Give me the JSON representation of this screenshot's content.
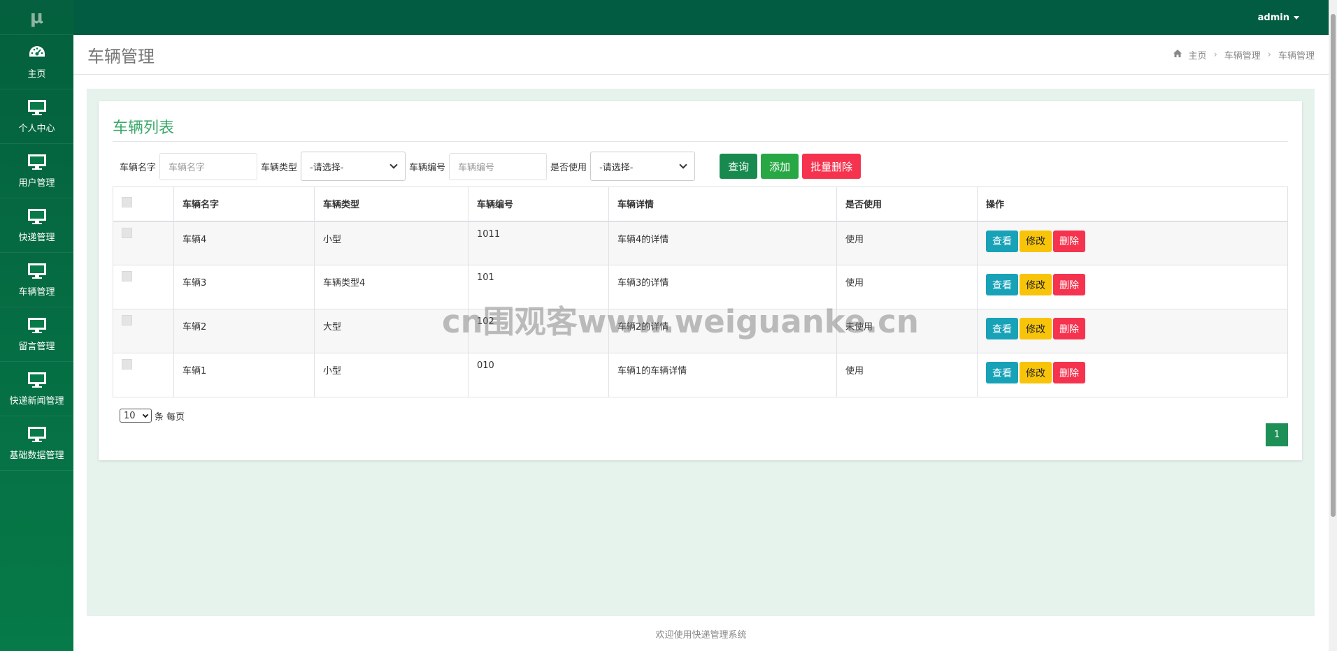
{
  "sidebar": {
    "logo": "μ",
    "items": [
      {
        "label": "主页",
        "icon": "dashboard-icon"
      },
      {
        "label": "个人中心",
        "icon": "monitor-icon"
      },
      {
        "label": "用户管理",
        "icon": "monitor-icon"
      },
      {
        "label": "快递管理",
        "icon": "monitor-icon"
      },
      {
        "label": "车辆管理",
        "icon": "monitor-icon"
      },
      {
        "label": "留言管理",
        "icon": "monitor-icon"
      },
      {
        "label": "快递新闻管理",
        "icon": "monitor-icon"
      },
      {
        "label": "基础数据管理",
        "icon": "monitor-icon"
      }
    ]
  },
  "topbar": {
    "user": "admin"
  },
  "titlebar": {
    "title": "车辆管理",
    "breadcrumb": [
      "主页",
      "车辆管理",
      "车辆管理"
    ]
  },
  "panel": {
    "title": "车辆列表",
    "filters": {
      "name_label": "车辆名字",
      "name_placeholder": "车辆名字",
      "type_label": "车辆类型",
      "type_value": "-请选择-",
      "number_label": "车辆编号",
      "number_placeholder": "车辆编号",
      "used_label": "是否使用",
      "used_value": "-请选择-"
    },
    "buttons": {
      "query": "查询",
      "add": "添加",
      "bulk_delete": "批量删除"
    }
  },
  "table": {
    "headers": [
      "车辆名字",
      "车辆类型",
      "车辆编号",
      "车辆详情",
      "是否使用",
      "操作"
    ],
    "rows": [
      {
        "name": "车辆4",
        "type": "小型",
        "number": "1011",
        "detail": "车辆4的详情",
        "used": "使用"
      },
      {
        "name": "车辆3",
        "type": "车辆类型4",
        "number": "101",
        "detail": "车辆3的详情",
        "used": "使用"
      },
      {
        "name": "车辆2",
        "type": "大型",
        "number": "102",
        "detail": "车辆2的详情",
        "used": "未使用"
      },
      {
        "name": "车辆1",
        "type": "小型",
        "number": "010",
        "detail": "车辆1的车辆详情",
        "used": "使用"
      }
    ],
    "ops": {
      "view": "查看",
      "edit": "修改",
      "delete": "删除"
    }
  },
  "pager": {
    "per_page": "10",
    "per_page_label": "条 每页",
    "current_page": "1"
  },
  "footer": "欢迎使用快递管理系统",
  "watermark": "cn围观客www.weiguanke.cn",
  "colors": {
    "sidebar": "#067a48",
    "topbar": "#025c41",
    "accent": "#3ba96a",
    "view": "#17a2b8",
    "edit": "#f7c40a",
    "delete": "#f5334e"
  }
}
